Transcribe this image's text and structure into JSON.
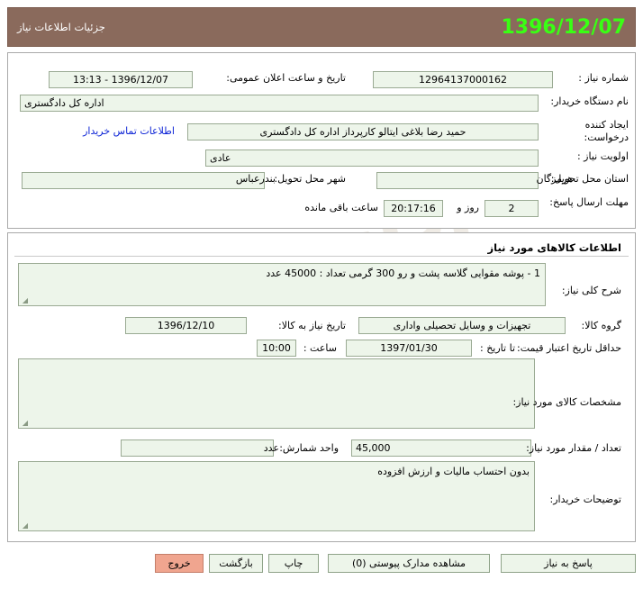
{
  "header": {
    "title": "جزئیات اطلاعات نیاز",
    "date": "1396/12/07",
    "bg_color": "#8a6a5c",
    "date_color": "#39ff14"
  },
  "watermark": {
    "text_1": "اداره",
    "text_2": "ارتباط"
  },
  "top_panel": {
    "need_number_label": "شماره نیاز :",
    "need_number_value": "12964137000162",
    "announce_datetime_label": "تاریخ و ساعت اعلان عمومی:",
    "announce_datetime_value": "1396/12/07 - 13:13",
    "buyer_org_label": "نام دستگاه خریدار:",
    "buyer_org_value": "اداره کل دادگستری",
    "creator_label": "ایجاد کننده درخواست:",
    "creator_value": "حمید رضا  بلاغی ایتالو کارپرداز اداره کل دادگستری",
    "contact_link": "اطلاعات تماس خریدار",
    "priority_label": "اولویت نیاز :",
    "priority_value": "عادی",
    "province_label": "استان محل تحویل:",
    "province_value": "هرمزگان",
    "city_label": "شهر محل تحویل:",
    "city_value": "بندرعباس",
    "deadline_label": "مهلت ارسال پاسخ:",
    "deadline_days": "2",
    "deadline_days_suffix": "روز و",
    "deadline_time": "20:17:16",
    "deadline_time_suffix": "ساعت باقی مانده"
  },
  "items_panel": {
    "section_title": "اطلاعات کالاهای مورد نیاز",
    "summary_label": "شرح کلی نیاز:",
    "summary_value": "1 - پوشه مقوایی گلاسه پشت و رو 300 گرمی   تعداد : 45000 عدد",
    "group_label": "گروه کالا:",
    "group_value": "تجهیزات و وسایل تحصیلی واداری",
    "need_date_label": "تاریخ نیاز به کالا:",
    "need_date_value": "1396/12/10",
    "price_valid_label": "حداقل تاریخ اعتبار قیمت:",
    "price_valid_to_label": "تا تاریخ :",
    "price_valid_to_value": "1397/01/30",
    "price_valid_time_label": "ساعت :",
    "price_valid_time_value": "10:00",
    "specs_label": "مشخصات کالای مورد نیاز:",
    "specs_value": "",
    "quantity_label": "تعداد / مقدار مورد نیاز:",
    "quantity_value": "45,000",
    "unit_label": "واحد شمارش:",
    "unit_value": "عدد",
    "buyer_notes_label": "توضیحات خریدار:",
    "buyer_notes_value": "بدون احتساب مالیات و ارزش افزوده"
  },
  "footer": {
    "exit_button": "خروج",
    "back_button": "بازگشت",
    "print_button": "چاپ",
    "attachments_button": "مشاهده مدارک پیوستی (0)",
    "respond_button": "پاسخ به نیاز"
  }
}
